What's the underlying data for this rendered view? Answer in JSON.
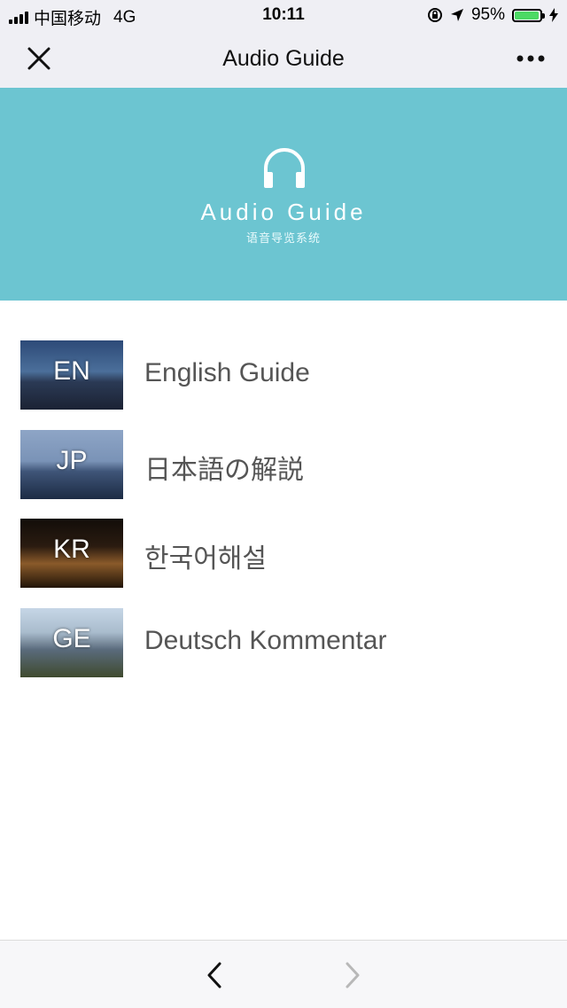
{
  "status": {
    "carrier": "中国移动",
    "network": "4G",
    "time": "10:11",
    "battery": "95%",
    "battery_level": 0.95
  },
  "navbar": {
    "title": "Audio Guide",
    "close_icon": "close-icon",
    "more_icon": "more-icon"
  },
  "banner": {
    "title": "Audio Guide",
    "subtitle": "语音导览系统",
    "icon": "headphone-icon",
    "color": "#6cc5d1"
  },
  "guides": [
    {
      "code": "EN",
      "label": "English Guide"
    },
    {
      "code": "JP",
      "label": "日本語の解説"
    },
    {
      "code": "KR",
      "label": "한국어해설"
    },
    {
      "code": "GE",
      "label": "Deutsch Kommentar"
    }
  ],
  "bottom": {
    "back_icon": "chevron-left-icon",
    "forward_icon": "chevron-right-icon"
  }
}
